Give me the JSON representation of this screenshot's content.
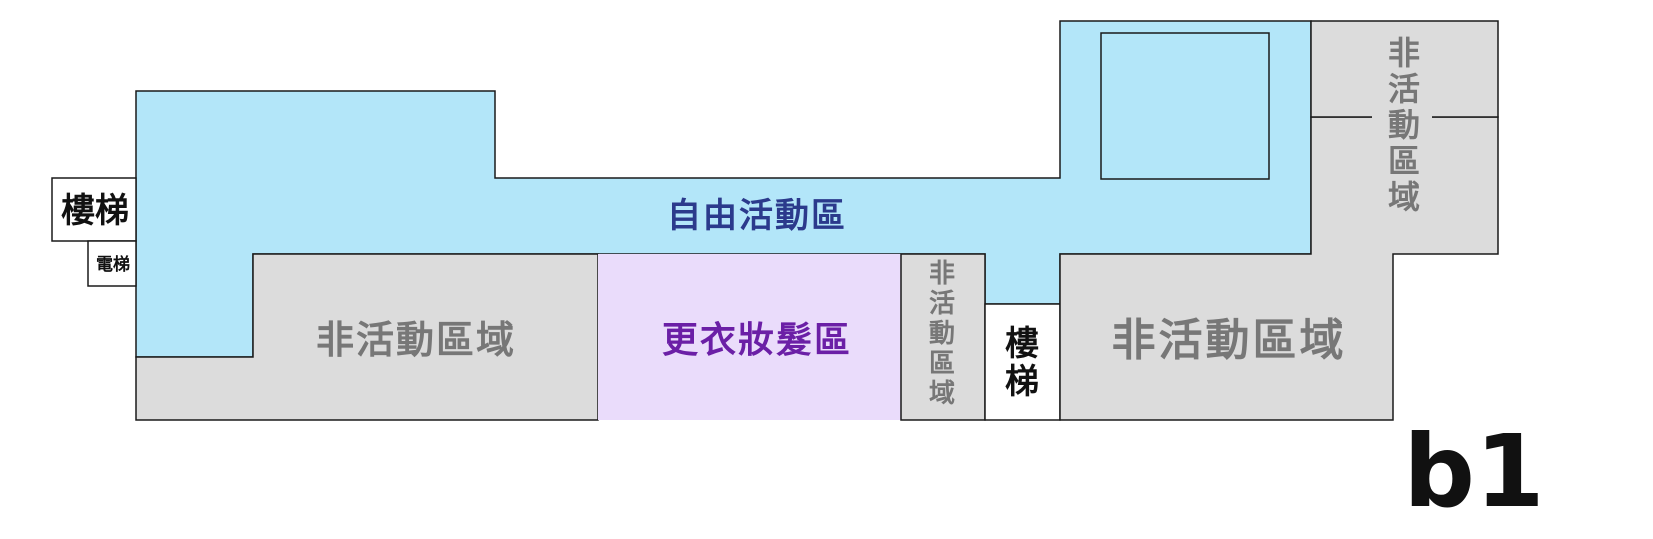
{
  "floor_label": "b1",
  "zones": {
    "free_activity": "自由活動區",
    "dressing": "更衣妝髮區",
    "non_active_left": "非活動區域",
    "non_active_mid_vertical": "非活動區域",
    "non_active_right": "非活動區域",
    "non_active_top_right_vertical": "非活動區域"
  },
  "stairs": {
    "left": "樓梯",
    "middle": "樓梯"
  },
  "elevator": "電梯",
  "colors": {
    "free_activity_fill": "#b3e6f9",
    "free_activity_text": "#2b3a8c",
    "dressing_fill": "#eadcfb",
    "dressing_text": "#6b1fa6",
    "non_active_fill": "#dcdcdc",
    "non_active_text": "#777777",
    "stairs_fill": "#ffffff",
    "outline": "#1a1a1a"
  }
}
